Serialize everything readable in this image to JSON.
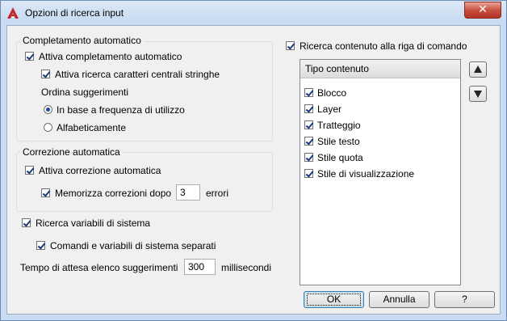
{
  "window": {
    "title": "Opzioni di ricerca input"
  },
  "autocomplete": {
    "group_title": "Completamento automatico",
    "enable_label": "Attiva completamento automatico",
    "enable_checked": true,
    "midstring_label": "Attiva ricerca caratteri centrali stringhe",
    "midstring_checked": true,
    "sort_label": "Ordina suggerimenti",
    "sort_options": [
      {
        "label": "In base a frequenza di utilizzo",
        "selected": true
      },
      {
        "label": "Alfabeticamente",
        "selected": false
      }
    ]
  },
  "autocorrect": {
    "group_title": "Correzione automatica",
    "enable_label": "Attiva correzione automatica",
    "enable_checked": true,
    "remember_label": "Memorizza correzioni dopo",
    "remember_checked": true,
    "remember_value": "3",
    "remember_unit": "errori"
  },
  "sysvars": {
    "search_label": "Ricerca variabili di sistema",
    "search_checked": true,
    "separate_label": "Comandi e variabili di sistema separati",
    "separate_checked": true
  },
  "delay": {
    "label": "Tempo di attesa elenco suggerimenti",
    "value": "300",
    "unit": "millisecondi"
  },
  "content_search": {
    "label": "Ricerca contenuto alla riga di comando",
    "checked": true,
    "list_header": "Tipo contenuto",
    "items": [
      {
        "label": "Blocco",
        "checked": true
      },
      {
        "label": "Layer",
        "checked": true
      },
      {
        "label": "Tratteggio",
        "checked": true
      },
      {
        "label": "Stile testo",
        "checked": true
      },
      {
        "label": "Stile quota",
        "checked": true
      },
      {
        "label": "Stile di visualizzazione",
        "checked": true
      }
    ],
    "up_icon": "triangle-up",
    "down_icon": "triangle-down"
  },
  "buttons": {
    "ok": "OK",
    "cancel": "Annulla",
    "help": "?"
  },
  "colors": {
    "app_icon": "#c0282c",
    "close_button": "#c75041",
    "title_bar": "#c5d9f0"
  }
}
